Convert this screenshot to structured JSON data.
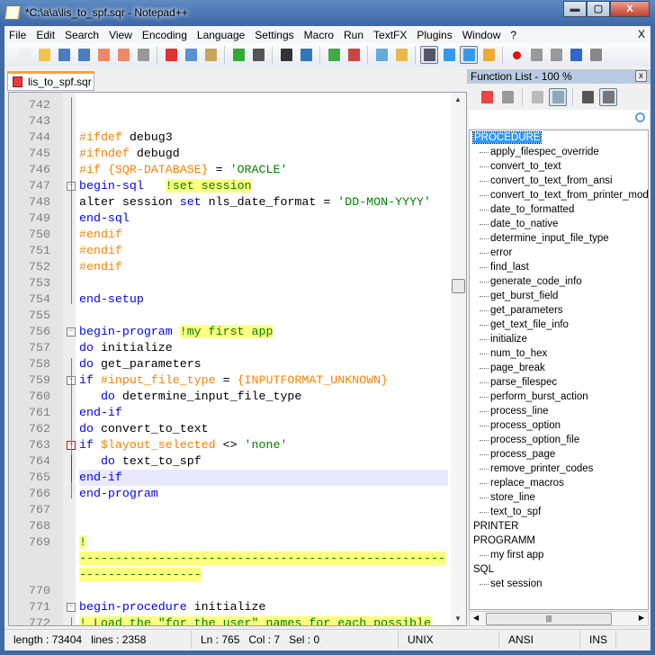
{
  "window": {
    "title": "*C:\\a\\a\\lis_to_spf.sqr - Notepad++",
    "minimize": "▬",
    "maximize": "▢",
    "close": "X"
  },
  "menu": [
    "File",
    "Edit",
    "Search",
    "View",
    "Encoding",
    "Language",
    "Settings",
    "Macro",
    "Run",
    "TextFX",
    "Plugins",
    "Window",
    "?"
  ],
  "menu_close": "X",
  "toolbar": [
    "new",
    "open",
    "save",
    "save-all",
    "close",
    "close-all",
    "print",
    "cut",
    "copy",
    "paste",
    "undo",
    "redo",
    "find",
    "replace",
    "zoom-in",
    "zoom-out",
    "sync-v",
    "sync-h",
    "word-wrap",
    "show-all-chars",
    "indent-guide",
    "function-list",
    "record-macro",
    "stop-macro",
    "play-macro",
    "run-macro-multiple",
    "save-macro"
  ],
  "tab": {
    "label": "lis_to_spf.sqr"
  },
  "editor": {
    "current_line": 765,
    "lines": [
      {
        "n": "742",
        "t": []
      },
      {
        "n": "743",
        "t": []
      },
      {
        "n": "744",
        "t": [
          [
            "pp",
            "#ifdef"
          ],
          [
            "tx",
            " debug3"
          ]
        ]
      },
      {
        "n": "745",
        "t": [
          [
            "pp",
            "#ifndef"
          ],
          [
            "tx",
            " debugd"
          ]
        ]
      },
      {
        "n": "746",
        "t": [
          [
            "pp",
            "#if {SQR-DATABASE}"
          ],
          [
            "tx",
            " = "
          ],
          [
            "str",
            "'ORACLE'"
          ]
        ]
      },
      {
        "n": "747",
        "fold": "box",
        "t": [
          [
            "kw",
            "begin-sql"
          ],
          [
            "tx",
            "   "
          ],
          [
            "cm",
            "!set session"
          ]
        ]
      },
      {
        "n": "748",
        "t": [
          [
            "tx",
            "alter session "
          ],
          [
            "kw",
            "set"
          ],
          [
            "tx",
            " nls_date_format = "
          ],
          [
            "str",
            "'DD-MON-YYYY'"
          ]
        ]
      },
      {
        "n": "749",
        "t": [
          [
            "kw",
            "end-sql"
          ]
        ]
      },
      {
        "n": "750",
        "t": [
          [
            "pp",
            "#endif"
          ]
        ]
      },
      {
        "n": "751",
        "t": [
          [
            "pp",
            "#endif"
          ]
        ]
      },
      {
        "n": "752",
        "t": [
          [
            "pp",
            "#endif"
          ]
        ]
      },
      {
        "n": "753",
        "t": []
      },
      {
        "n": "754",
        "t": [
          [
            "kw",
            "end-setup"
          ]
        ]
      },
      {
        "n": "755",
        "t": []
      },
      {
        "n": "756",
        "fold": "box",
        "t": [
          [
            "kw",
            "begin-program"
          ],
          [
            "tx",
            " "
          ],
          [
            "cm",
            "!my first app"
          ]
        ]
      },
      {
        "n": "757",
        "t": [
          [
            "kw",
            "do"
          ],
          [
            "tx",
            " initialize"
          ]
        ]
      },
      {
        "n": "758",
        "t": [
          [
            "kw",
            "do"
          ],
          [
            "tx",
            " get_parameters"
          ]
        ]
      },
      {
        "n": "759",
        "fold": "box",
        "t": [
          [
            "kw",
            "if"
          ],
          [
            "tx",
            " "
          ],
          [
            "pp",
            "#input_file_type"
          ],
          [
            "tx",
            " = "
          ],
          [
            "pp",
            "{INPUTFORMAT_UNKNOWN}"
          ]
        ]
      },
      {
        "n": "760",
        "t": [
          [
            "tx",
            "   "
          ],
          [
            "kw",
            "do"
          ],
          [
            "tx",
            " determine_input_file_type"
          ]
        ]
      },
      {
        "n": "761",
        "t": [
          [
            "kw",
            "end-if"
          ]
        ]
      },
      {
        "n": "762",
        "t": [
          [
            "kw",
            "do"
          ],
          [
            "tx",
            " convert_to_text"
          ]
        ]
      },
      {
        "n": "763",
        "fold": "red",
        "t": [
          [
            "kw",
            "if"
          ],
          [
            "tx",
            " "
          ],
          [
            "pp",
            "$layout_selected"
          ],
          [
            "tx",
            " <> "
          ],
          [
            "str",
            "'none'"
          ]
        ]
      },
      {
        "n": "764",
        "t": [
          [
            "tx",
            "   "
          ],
          [
            "kw",
            "do"
          ],
          [
            "tx",
            " text_to_spf"
          ]
        ]
      },
      {
        "n": "765",
        "t": [
          [
            "kw",
            "end-if"
          ]
        ]
      },
      {
        "n": "766",
        "t": [
          [
            "kw",
            "end-program"
          ]
        ]
      },
      {
        "n": "767",
        "t": []
      },
      {
        "n": "768",
        "t": []
      },
      {
        "n": "769",
        "t": [
          [
            "cm",
            "!"
          ]
        ]
      },
      {
        "n": "",
        "t": [
          [
            "cm",
            "---------------------------------------------------"
          ]
        ]
      },
      {
        "n": "",
        "t": [
          [
            "cm",
            "-----------------"
          ]
        ]
      },
      {
        "n": "770",
        "t": []
      },
      {
        "n": "771",
        "fold": "box",
        "t": [
          [
            "kw",
            "begin-procedure"
          ],
          [
            "tx",
            " initialize"
          ]
        ]
      },
      {
        "n": "772",
        "t": [
          [
            "cm",
            "! Load the \"for the user\" names for each possible"
          ]
        ]
      }
    ]
  },
  "function_list": {
    "title": "Function List - 100 %",
    "close": "x",
    "tools": [
      "back-to-source",
      "reload",
      "sort-default",
      "sort-alpha",
      "list-view",
      "tree-view"
    ],
    "search_value": "",
    "tree": [
      {
        "label": "PROCEDURE",
        "selected": true,
        "children": [
          "apply_filespec_override",
          "convert_to_text",
          "convert_to_text_from_ansi",
          "convert_to_text_from_printer_mode",
          "date_to_formatted",
          "date_to_native",
          "determine_input_file_type",
          "error",
          "find_last",
          "generate_code_info",
          "get_burst_field",
          "get_parameters",
          "get_text_file_info",
          "initialize",
          "num_to_hex",
          "page_break",
          "parse_filespec",
          "perform_burst_action",
          "process_line",
          "process_option",
          "process_option_file",
          "process_page",
          "remove_printer_codes",
          "replace_macros",
          "store_line",
          "text_to_spf"
        ]
      },
      {
        "label": "PRINTER",
        "children": []
      },
      {
        "label": "PROGRAMM",
        "children": [
          "my first app"
        ]
      },
      {
        "label": "SQL",
        "children": [
          "set session"
        ]
      }
    ]
  },
  "status": {
    "length": "length : 73404",
    "lines": "lines : 2358",
    "ln": "Ln : 765",
    "col": "Col : 7",
    "sel": "Sel : 0",
    "eol": "UNIX",
    "encoding": "ANSI",
    "mode": "INS"
  }
}
